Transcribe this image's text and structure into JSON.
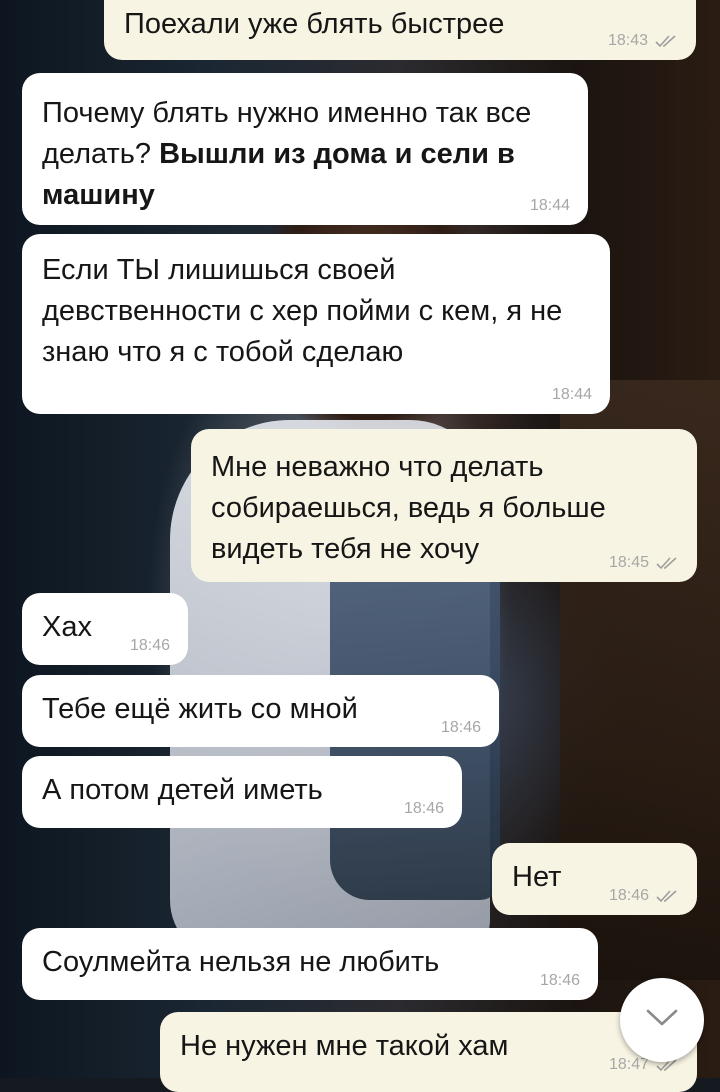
{
  "messages": [
    {
      "id": "m1",
      "dir": "out",
      "text": "Поехали уже блять быстрее",
      "time": "18:43",
      "read": true
    },
    {
      "id": "m2",
      "dir": "in",
      "text": "Почему блять нужно именно так все делать?",
      "bold": "Вышли из дома и сели в машину",
      "time": "18:44"
    },
    {
      "id": "m3",
      "dir": "in",
      "text": "Если ТЫ лишишься своей девственности с хер пойми с кем, я не знаю что я с тобой сделаю",
      "time": "18:44"
    },
    {
      "id": "m4",
      "dir": "out",
      "text": "Мне неважно что делать собираешься, ведь я больше видеть тебя не хочу",
      "time": "18:45",
      "read": true
    },
    {
      "id": "m5",
      "dir": "in",
      "text": "Хах",
      "time": "18:46"
    },
    {
      "id": "m6",
      "dir": "in",
      "text": "Тебе ещё жить со мной",
      "time": "18:46"
    },
    {
      "id": "m7",
      "dir": "in",
      "text": "А потом детей иметь",
      "time": "18:46"
    },
    {
      "id": "m8",
      "dir": "out",
      "text": "Нет",
      "time": "18:46",
      "read": true
    },
    {
      "id": "m9",
      "dir": "in",
      "text": "Соулмейта нельзя не любить",
      "time": "18:46"
    },
    {
      "id": "m10",
      "dir": "out",
      "text": "Не нужен мне такой хам",
      "time": "18:47",
      "read": true
    }
  ],
  "colors": {
    "incoming_bubble": "#ffffff",
    "outgoing_bubble": "#f8f4e3",
    "time_text": "#a7a7a7",
    "read_checks": "#9e9e9e"
  },
  "icons": {
    "read_receipt": "double-check-icon",
    "scroll_down": "chevron-down-icon"
  }
}
